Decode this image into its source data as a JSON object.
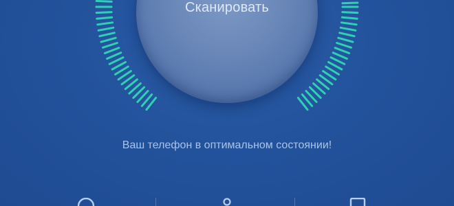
{
  "scan_button": {
    "label": "Сканировать"
  },
  "status": {
    "message": "Ваш телефон в оптимальном состоянии!"
  },
  "bottom_nav": {
    "icons": [
      "security-icon",
      "cleanup-icon",
      "battery-icon"
    ]
  },
  "colors": {
    "background": "#22519a",
    "gauge_tick": "#2fd1b4",
    "button": "#6785b6",
    "status_text": "#a9c3ea"
  }
}
